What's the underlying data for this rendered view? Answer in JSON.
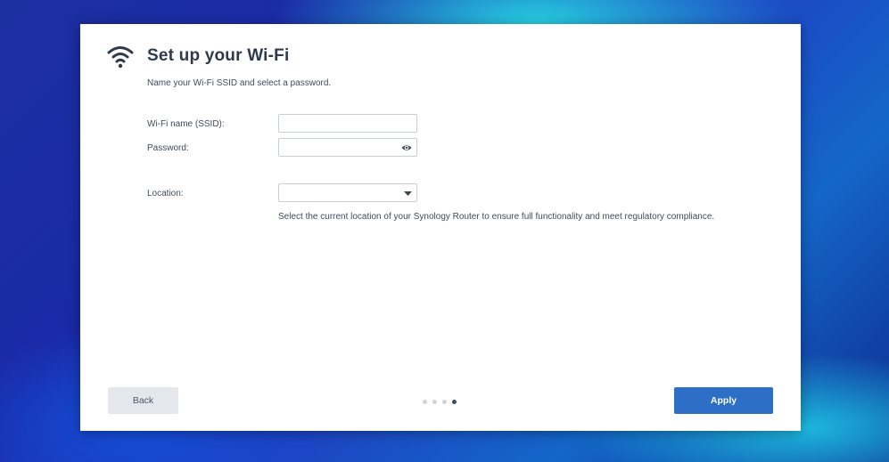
{
  "header": {
    "icon": "wifi-icon",
    "title": "Set up your Wi-Fi",
    "subtitle": "Name your Wi-Fi SSID and select a password."
  },
  "form": {
    "ssid_label": "Wi-Fi name (SSID):",
    "ssid_value": "",
    "password_label": "Password:",
    "password_value": "",
    "password_toggle_icon": "eye-icon",
    "location_label": "Location:",
    "location_value": "",
    "location_dropdown_icon": "caret-down-icon",
    "location_hint": "Select the current location of your Synology Router to ensure full functionality and meet regulatory compliance."
  },
  "footer": {
    "back_label": "Back",
    "apply_label": "Apply",
    "steps_total": 4,
    "current_step": 4
  },
  "colors": {
    "accent": "#2d6ec7",
    "title_text": "#2f3a4a",
    "body_text": "#414b5a",
    "secondary_button": "#e4e8ed"
  }
}
